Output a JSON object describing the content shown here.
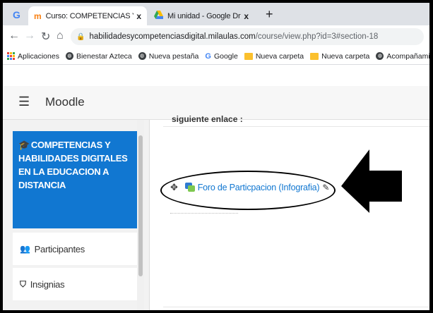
{
  "browser": {
    "tabs": [
      {
        "title": "Curso: COMPETENCIAS Y HABILI",
        "icon": "moodle-icon",
        "active": true
      },
      {
        "title": "Mi unidad - Google Drive",
        "icon": "google-drive-icon",
        "active": false
      }
    ],
    "newtab_label": "+",
    "close_glyph": "x",
    "url_host": "habilidadesycompetenciasdigital.milaulas.com",
    "url_path": "/course/view.php?id=3#section-18",
    "bookmarks": [
      "Aplicaciones",
      "Bienestar Azteca",
      "Nueva pestaña",
      "Google",
      "Nueva carpeta",
      "Nueva carpeta",
      "Acompañamiento P..."
    ]
  },
  "moodle": {
    "brand": "Moodle",
    "drawer": {
      "course_name": "COMPETENCIAS Y HABILIDADES DIGITALES EN LA EDUCACION A DISTANCIA",
      "items": [
        "Participantes",
        "Insignias"
      ]
    },
    "main": {
      "cut_text": "siguiente enlace :",
      "activity_label": "Foro de Particpacion (Infografia)"
    }
  },
  "colors": {
    "accent": "#1177d1",
    "tab_strip": "#dee1e6"
  }
}
